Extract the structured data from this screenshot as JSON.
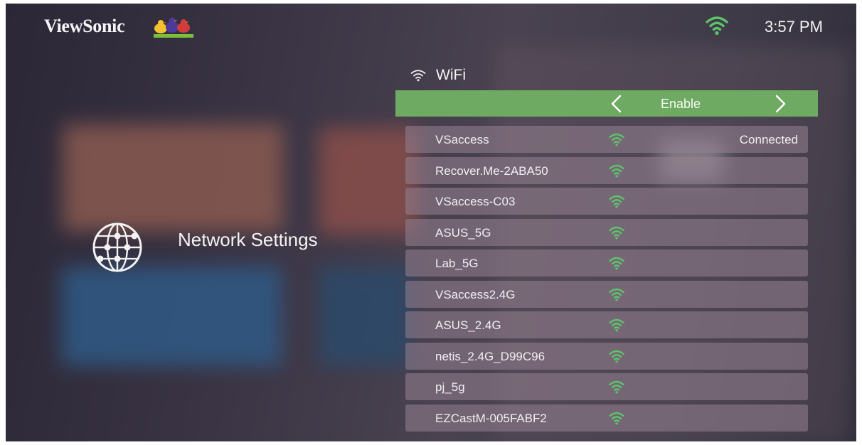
{
  "brand": {
    "name": "ViewSonic",
    "logo_icon": "viewsonic-birds-logo"
  },
  "status_bar": {
    "wifi_icon": "wifi-connected-icon",
    "time": "3:57 PM",
    "wifi_color": "#5cc46a"
  },
  "section": {
    "icon": "network-globe-icon",
    "title": "Network Settings"
  },
  "wifi_panel": {
    "header_icon": "wifi-icon",
    "title": "WiFi",
    "toggle": {
      "value": "Enable",
      "prev_icon": "chevron-left-icon",
      "next_icon": "chevron-right-icon",
      "color": "#6faa63"
    },
    "networks": [
      {
        "ssid": "VSaccess",
        "status": "Connected"
      },
      {
        "ssid": "Recover.Me-2ABA50",
        "status": ""
      },
      {
        "ssid": "VSaccess-C03",
        "status": ""
      },
      {
        "ssid": "ASUS_5G",
        "status": ""
      },
      {
        "ssid": "Lab_5G",
        "status": ""
      },
      {
        "ssid": "VSaccess2.4G",
        "status": ""
      },
      {
        "ssid": "ASUS_2.4G",
        "status": ""
      },
      {
        "ssid": "netis_2.4G_D99C96",
        "status": ""
      },
      {
        "ssid": "pj_5g",
        "status": ""
      },
      {
        "ssid": "EZCastM-005FABF2",
        "status": ""
      }
    ]
  }
}
